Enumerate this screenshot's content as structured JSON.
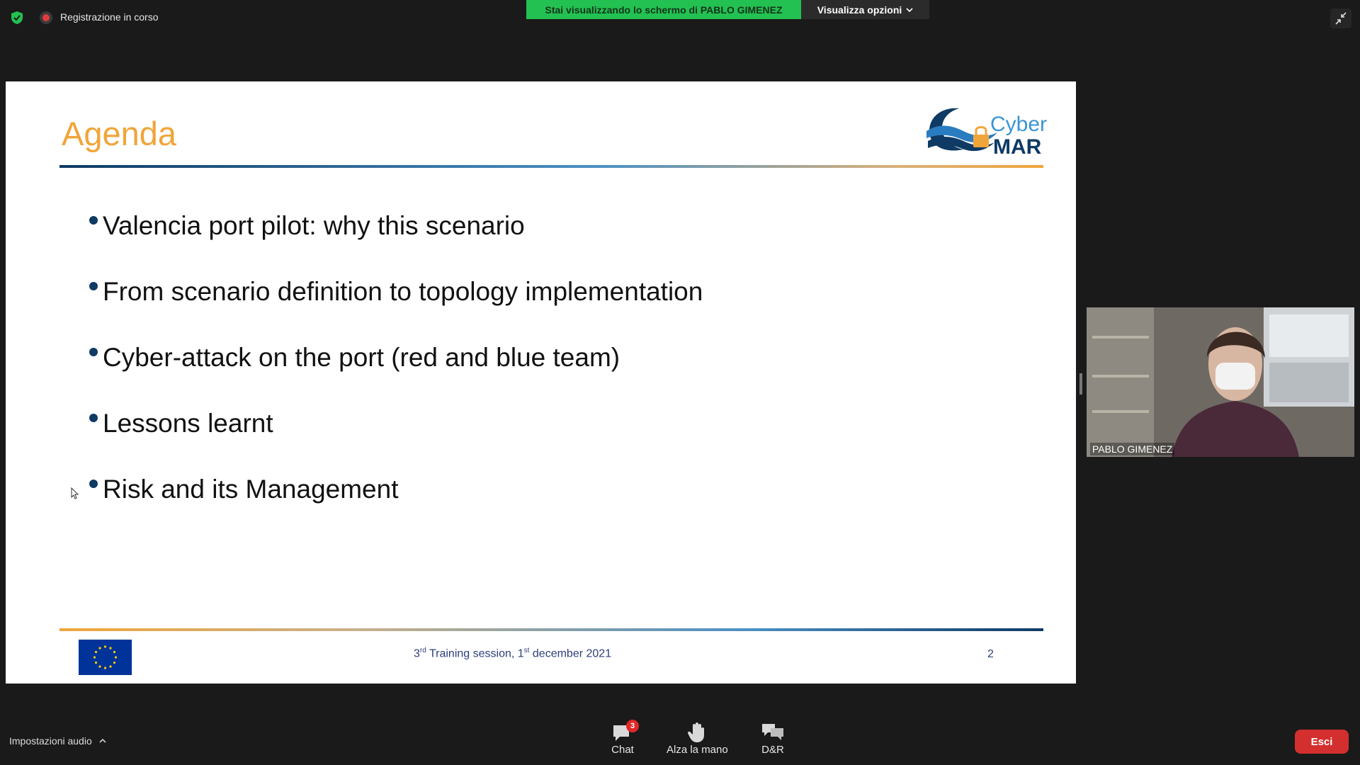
{
  "topbar": {
    "recording_text": "Registrazione in corso",
    "share_banner": "Stai visualizzando lo schermo di PABLO GIMENEZ",
    "view_options": "Visualizza opzioni"
  },
  "slide": {
    "title": "Agenda",
    "logo_text_top": "Cyber",
    "logo_text_bottom": "MAR",
    "bullets": [
      "Valencia port pilot: why this scenario",
      "From scenario definition to topology implementation",
      "Cyber-attack on the port (red and blue team)",
      "Lessons learnt",
      "Risk and its Management"
    ],
    "footer": {
      "ordinal": "3",
      "ordinal_suffix": "rd",
      "session_text": " Training session, 1",
      "day_suffix": "st",
      "date_text": " december 2021",
      "page_number": "2"
    },
    "colors": {
      "title": "#f0a53a",
      "navy": "#0e3a64"
    }
  },
  "participant": {
    "name": "PABLO GIMENEZ"
  },
  "toolbar": {
    "audio_settings": "Impostazioni audio",
    "chat_label": "Chat",
    "chat_badge": "3",
    "raise_hand_label": "Alza la mano",
    "qa_label": "D&R",
    "exit_label": "Esci"
  }
}
